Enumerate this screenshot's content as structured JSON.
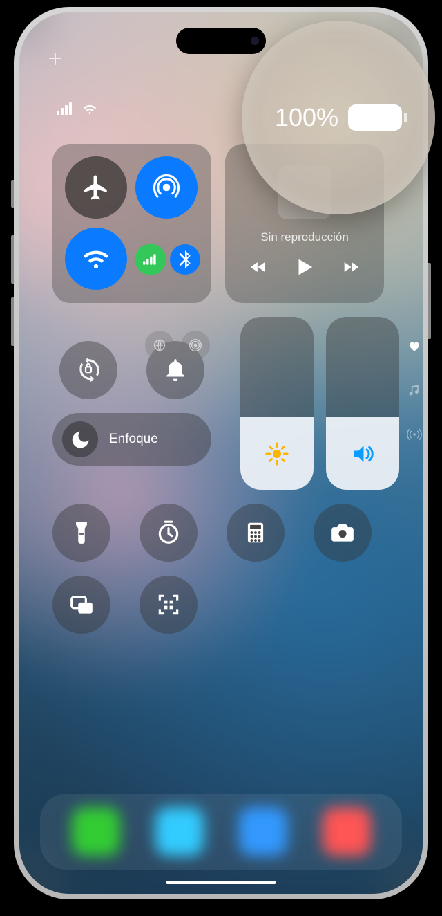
{
  "status": {
    "battery_percent": "100%",
    "cellular_bars": 4,
    "wifi_on": true
  },
  "magnify": {
    "battery_percent": "100%"
  },
  "connectivity": {
    "airplane": false,
    "airdrop": true,
    "wifi": true,
    "cellular": true,
    "bluetooth": true
  },
  "media": {
    "title": "Sin reproducción"
  },
  "focus": {
    "label": "Enfoque"
  },
  "sliders": {
    "brightness": 0.42,
    "volume": 0.42
  },
  "colors": {
    "accent_blue": "#0a7aff",
    "accent_green": "#34c759"
  },
  "icons": {
    "flashlight": "flashlight-icon",
    "timer": "timer-icon",
    "calculator": "calculator-icon",
    "camera": "camera-icon",
    "screen_mirror": "screen-mirroring-icon",
    "qr": "qr-scan-icon",
    "lock": "rotation-lock-icon",
    "bell": "silent-bell-icon"
  }
}
